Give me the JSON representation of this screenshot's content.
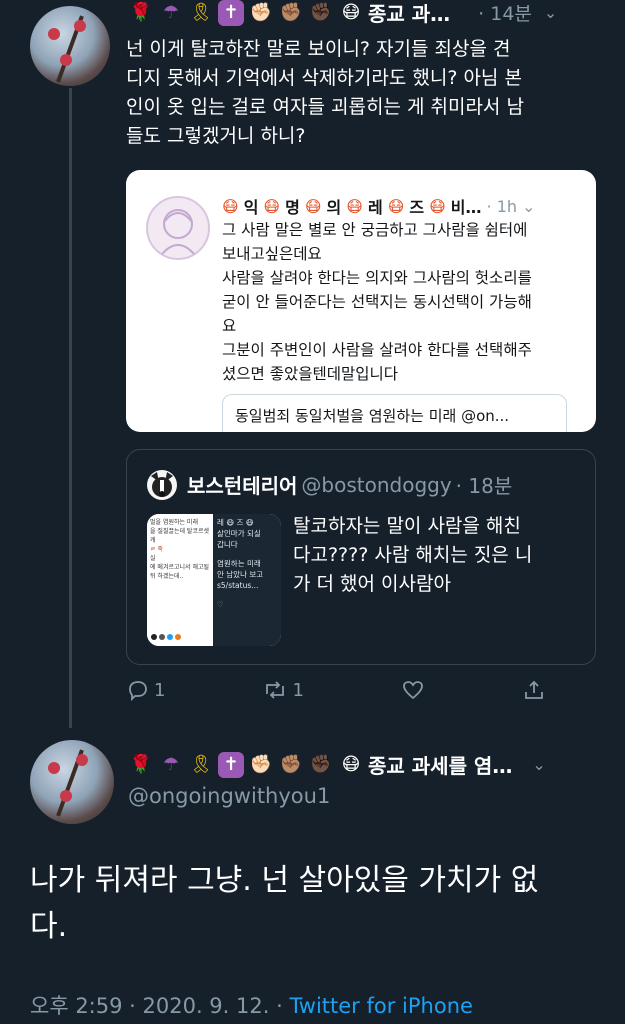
{
  "reply_tweet": {
    "display_name": "종교 과…",
    "time": "· 14분",
    "emojis": [
      "🌹",
      "☂",
      "🎗",
      "✝",
      "✊🏻",
      "✊🏽",
      "✊🏿",
      "😷"
    ],
    "text_lines": [
      "넌 이게 탈코하잔 말로 보이니? 자기들 죄상을 견",
      "디지 못해서 기억에서 삭제하기라도 했니? 아님 본",
      "인이 옷 입는 걸로 여자들 괴롭히는 게 취미라서 남",
      "들도 그렇겠거니 하니?"
    ]
  },
  "screenshot_card": {
    "name_fragments": [
      "익",
      "명",
      "의",
      "레",
      "즈",
      "비…"
    ],
    "time": "· 1h",
    "text_lines": [
      "그 사람 말은 별로 안 궁금하고 그사람을 쉼터에",
      "보내고싶은데요",
      "사람을 살려야 한다는 의지와 그사람의 헛소리를",
      "굳이 안 들어준다는 선택지는 동시선택이 가능해",
      "요",
      "그분이 주변인이 사람을 살려야 한다를 선택해주",
      "셨으면 좋았을텐데말입니다"
    ],
    "nested_quote": "동일범죄 동일처벌을 염원하는 미래 @on..."
  },
  "quoted_tweet": {
    "display_name": "보스턴테리어",
    "handle": "@bostondoggy",
    "time": "· 18분",
    "text_lines": [
      "탈코하자는 말이 사람을 해친",
      "다고???? 사람 해치는 짓은 니",
      "가 더 했어 이사람아"
    ],
    "thumb_left_lines": [
      "벌을 염원하는 미래",
      "을 질질끌는데 탈코르셋 캐",
      "ㄹ 죽",
      "실",
      "에 메겨르고니서 해고될",
      "뒤 하겠는데.."
    ],
    "thumb_right_lines": [
      "레",
      "즈",
      "살인마가 되실",
      "갑니다",
      "염원하는 미래",
      "안 남았나 보고",
      "s5/status..."
    ]
  },
  "actions": {
    "reply_count": "1",
    "retweet_count": "1"
  },
  "main_tweet": {
    "display_name": "종교 과세를 염…",
    "handle": "@ongoingwithyou1",
    "emojis": [
      "🌹",
      "☂",
      "🎗",
      "✝",
      "✊🏻",
      "✊🏽",
      "✊🏿",
      "😷"
    ],
    "text_lines": [
      "나가 뒤져라 그냥. 넌 살아있을 가치가 없",
      "다."
    ],
    "timestamp": "오후 2:59 · 2020. 9. 12. · ",
    "source": "Twitter for iPhone"
  },
  "colors": {
    "background": "#15202b",
    "secondary_text": "#8899a6",
    "link": "#1da1f2",
    "border": "#38444d"
  }
}
